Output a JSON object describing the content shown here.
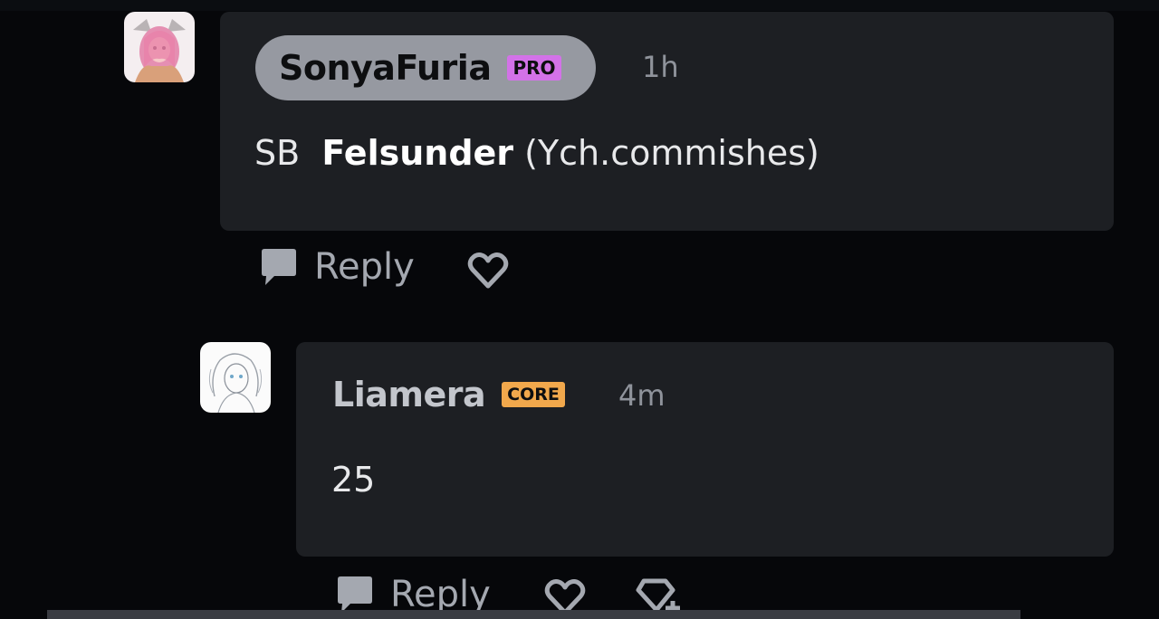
{
  "comments": [
    {
      "username": "SonyaFuria",
      "badge": "PRO",
      "time": "1h",
      "prefix": "SB",
      "mention": "Felsunder",
      "suffix": "(Ych.commishes)",
      "reply_label": "Reply"
    },
    {
      "username": "Liamera",
      "badge": "CORE",
      "time": "4m",
      "text": "25",
      "reply_label": "Reply"
    }
  ],
  "icons": {
    "reply": "speech-bubble-icon",
    "like": "heart-icon",
    "add_fave": "heart-plus-icon"
  },
  "colors": {
    "pro_badge": "#d372e8",
    "core_badge": "#f1a84c",
    "bubble": "#1d1f23",
    "background": "#06070a"
  }
}
